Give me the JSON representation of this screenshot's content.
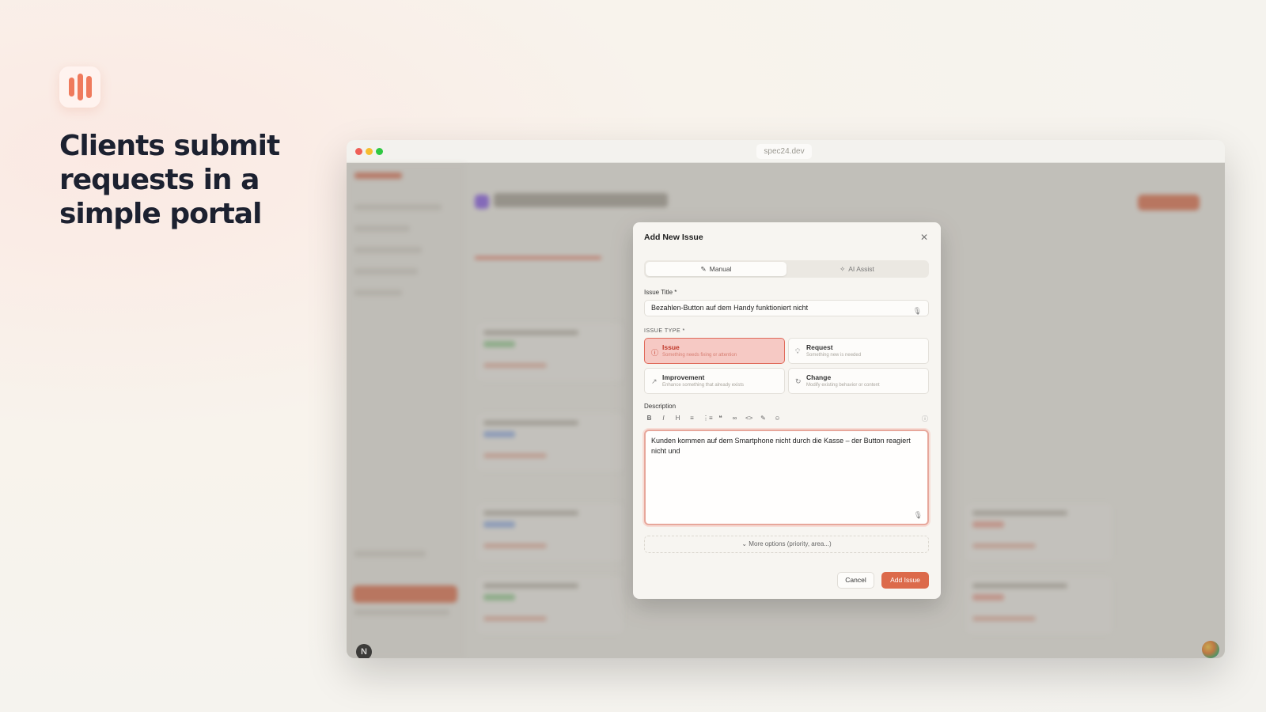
{
  "hero": {
    "headline": "Clients submit requests in a simple portal"
  },
  "browser": {
    "url": "spec24.dev"
  },
  "modal": {
    "title": "Add New Issue",
    "close_icon": "close-icon",
    "tabs": [
      {
        "label": "Manual",
        "icon": "pencil-icon",
        "active": true
      },
      {
        "label": "AI Assist",
        "icon": "sparkle-icon",
        "active": false
      }
    ],
    "title_field": {
      "label": "Issue Title *",
      "value": "Bezahlen-Button auf dem Handy funktioniert nicht"
    },
    "issue_type": {
      "label": "ISSUE TYPE *",
      "options": [
        {
          "name": "Issue",
          "desc": "Something needs fixing or attention",
          "selected": true
        },
        {
          "name": "Request",
          "desc": "Something new is needed",
          "selected": false
        },
        {
          "name": "Improvement",
          "desc": "Enhance something that already exists",
          "selected": false
        },
        {
          "name": "Change",
          "desc": "Modify existing behavior or content",
          "selected": false
        }
      ]
    },
    "description": {
      "label": "Description",
      "toolbar": [
        "B",
        "I",
        "H",
        "≡",
        "⋮≡",
        "❝",
        "∞",
        "<>",
        "✎",
        "☺"
      ],
      "value": "Kunden kommen auf dem Smartphone nicht durch die Kasse – der Button reagiert nicht und"
    },
    "more_options": "More options (priority, area...)",
    "cancel_label": "Cancel",
    "submit_label": "Add Issue"
  },
  "colors": {
    "accent": "#dc6a4b",
    "selected_card_bg": "#f6c9c4",
    "logo": "#ef7a5c"
  },
  "footer_badge": "N"
}
